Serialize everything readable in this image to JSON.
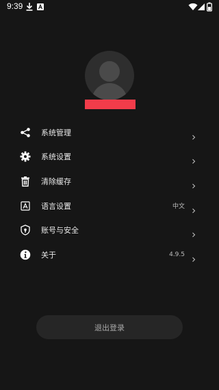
{
  "status_bar": {
    "time": "9:39",
    "left_icons": [
      "download-icon",
      "translate-app-icon"
    ],
    "right_icons": [
      "wifi-icon",
      "signal-icon",
      "battery-icon"
    ]
  },
  "profile": {
    "avatar": "default-avatar",
    "username_redacted_color": "#f23c4a"
  },
  "menu": {
    "items": [
      {
        "label": "系统管理",
        "value": "",
        "icon": "share-nodes-icon"
      },
      {
        "label": "系统设置",
        "value": "",
        "icon": "gear-icon"
      },
      {
        "label": "清除缓存",
        "value": "",
        "icon": "trash-icon"
      },
      {
        "label": "语言设置",
        "value": "中文",
        "icon": "language-icon"
      },
      {
        "label": "账号与安全",
        "value": "",
        "icon": "shield-icon"
      },
      {
        "label": "关于",
        "value": "4.9.5",
        "icon": "info-icon"
      }
    ]
  },
  "logout": {
    "label": "退出登录"
  },
  "colors": {
    "background": "#161616",
    "accent_redact": "#f23c4a",
    "button_bg": "#262626"
  }
}
